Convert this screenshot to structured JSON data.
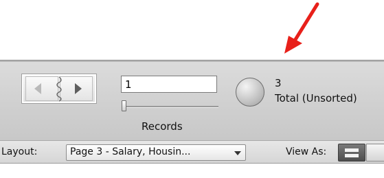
{
  "toolbar": {
    "record_number": "1",
    "records_label": "Records",
    "total_count": "3",
    "total_label": "Total (Unsorted)",
    "icons": {
      "book": "record-book-icon",
      "prev": "previous-record-icon",
      "next": "next-record-icon",
      "pie": "sort-status-pie-icon",
      "arrow": "red-annotation-arrow"
    }
  },
  "layoutbar": {
    "layout_label": "Layout:",
    "layout_value": "Page 3 - Salary, Housin...",
    "view_as_label": "View As:",
    "icons": {
      "dropdown": "chevron-down-icon",
      "form_view": "form-view-icon",
      "list_view": "list-view-icon"
    }
  },
  "colors": {
    "arrow": "#e8201a",
    "toolbar_bg": "#cfcfcf",
    "view_active": "#555555"
  }
}
